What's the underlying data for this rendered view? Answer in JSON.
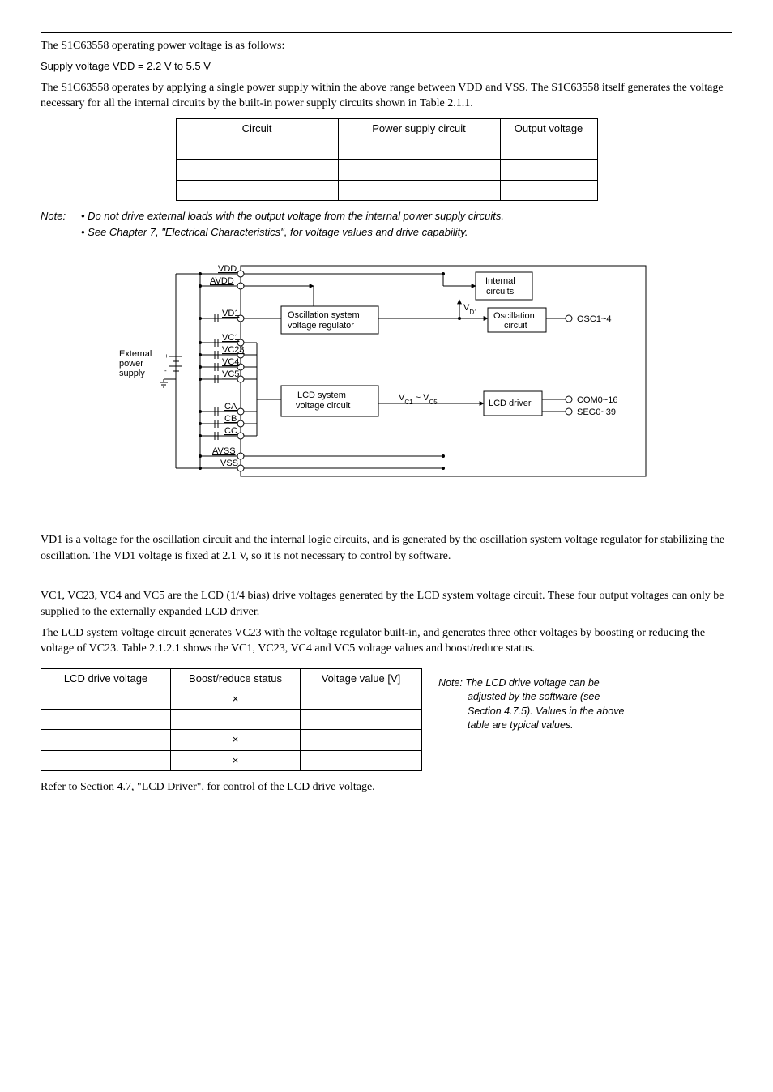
{
  "intro": {
    "p1": "The S1C63558 operating power voltage is as follows:",
    "supply": "Supply voltage VDD = 2.2 V to 5.5 V",
    "p2": "The S1C63558 operates by applying a single power supply within the above range between VDD and VSS. The S1C63558 itself generates the voltage necessary for all the internal circuits by the built-in power supply circuits shown in Table 2.1.1."
  },
  "circuit_table": {
    "headers": [
      "Circuit",
      "Power supply circuit",
      "Output voltage"
    ],
    "rows": [
      [
        "",
        "",
        ""
      ],
      [
        "",
        "",
        ""
      ],
      [
        "",
        "",
        ""
      ]
    ]
  },
  "notes": {
    "label": "Note:",
    "items": [
      "• Do not drive external loads with the output voltage from the internal power supply circuits.",
      "• See Chapter 7, \"Electrical Characteristics\", for voltage values and drive capability."
    ]
  },
  "diagram": {
    "labels": {
      "ext_power": "External\npower\nsupply",
      "vdd": "VDD",
      "avdd": "AVDD",
      "vd1": "VD1",
      "vc1": "VC1",
      "vc23": "VC23",
      "vc4": "VC4",
      "vc5": "VC5",
      "ca": "CA",
      "cb": "CB",
      "cc": "CC",
      "avss": "AVSS",
      "vss": "VSS",
      "osc_box": "Oscillation system\nvoltage regulator",
      "lcd_box": "LCD system\nvoltage circuit",
      "internal_box": "Internal\ncircuits",
      "osc_circ_box": "Oscillation\ncircuit",
      "lcd_driver_box": "LCD driver",
      "vd1_arrow": "VD1",
      "vc_arrow": "VC1 ~ VC5",
      "osc_out": "OSC1~4",
      "com_out": "COM0~16",
      "seg_out": "SEG0~39"
    }
  },
  "section_vd1": "VD1 is a voltage for the oscillation circuit and the internal logic circuits, and is generated by the oscillation system voltage regulator for stabilizing the oscillation. The VD1 voltage is fixed at 2.1 V, so it is not necessary to control by software.",
  "section_vc": {
    "p1": "VC1, VC23, VC4 and VC5 are the LCD (1/4 bias) drive voltages generated by the LCD system voltage circuit. These four output voltages can only be supplied to the externally expanded LCD driver.",
    "p2": "The LCD system voltage circuit generates VC23 with the voltage regulator built-in, and generates three other voltages by boosting or reducing the voltage of VC23. Table 2.1.2.1 shows the VC1, VC23, VC4 and VC5 voltage values and boost/reduce status."
  },
  "lcd_table": {
    "headers": [
      "LCD drive voltage",
      "Boost/reduce status",
      "Voltage value [V]"
    ],
    "rows": [
      [
        "",
        "×",
        ""
      ],
      [
        "",
        "",
        ""
      ],
      [
        "",
        "×",
        ""
      ],
      [
        "",
        "×",
        ""
      ]
    ]
  },
  "side_note": "Note: The LCD drive voltage can be adjusted by the software (see Section 4.7.5). Values in the above table are typical values.",
  "footer": "Refer to Section 4.7, \"LCD Driver\", for control of the LCD drive voltage."
}
